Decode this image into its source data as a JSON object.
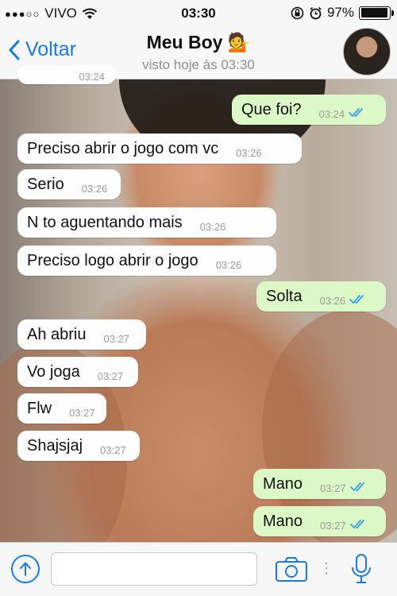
{
  "status_bar": {
    "carrier": "VIVO",
    "time": "03:30",
    "battery": "97%",
    "battery_level": 0.97,
    "icons": [
      "signal-dots-icon",
      "wifi-icon",
      "rotation-lock-icon",
      "alarm-icon",
      "battery-icon"
    ]
  },
  "nav": {
    "back_label": "Voltar",
    "title": "Meu Boy 💁",
    "subtitle": "visto hoje às 03:30"
  },
  "messages": [
    {
      "text": "Que foi?",
      "time": "03:24",
      "dir": "out"
    },
    {
      "text": "Preciso abrir o jogo com vc",
      "time": "03:26",
      "dir": "in"
    },
    {
      "text": "Serio",
      "time": "03:26",
      "dir": "in"
    },
    {
      "text": "N to aguentando mais",
      "time": "03:26",
      "dir": "in"
    },
    {
      "text": "Preciso logo abrir o jogo",
      "time": "03:26",
      "dir": "in"
    },
    {
      "text": "Solta",
      "time": "03:26",
      "dir": "out"
    },
    {
      "text": "Ah abriu",
      "time": "03:27",
      "dir": "in"
    },
    {
      "text": "Vo joga",
      "time": "03:27",
      "dir": "in"
    },
    {
      "text": "Flw",
      "time": "03:27",
      "dir": "in"
    },
    {
      "text": "Shajsjaj",
      "time": "03:27",
      "dir": "in"
    },
    {
      "text": "Mano",
      "time": "03:27",
      "dir": "out"
    },
    {
      "text": "Mano",
      "time": "03:27",
      "dir": "out"
    }
  ],
  "partial_message_time": "03:24",
  "input_bar": {
    "placeholder": "",
    "icons": [
      "upload-icon",
      "camera-icon",
      "microphone-icon"
    ]
  },
  "colors": {
    "accent": "#1a7ae0",
    "outgoing_bubble": "#dcf8c6",
    "incoming_bubble": "#fefefe",
    "read_ticks": "#34a0e8"
  }
}
